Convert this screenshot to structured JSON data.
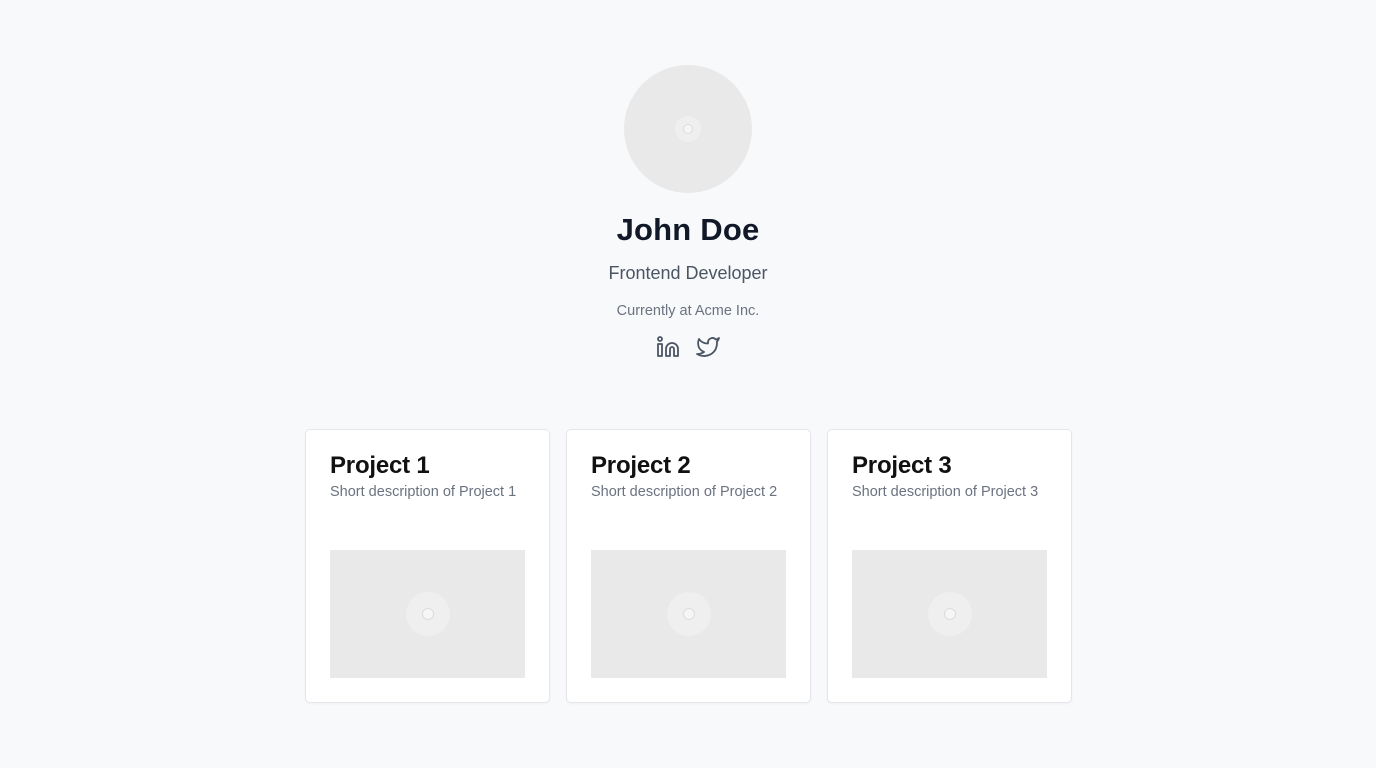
{
  "profile": {
    "avatar_icon": "image-placeholder-icon",
    "name": "John Doe",
    "role": "Frontend Developer",
    "company": "Currently at Acme Inc.",
    "socials": [
      {
        "icon": "linkedin-icon",
        "label": "LinkedIn"
      },
      {
        "icon": "twitter-icon",
        "label": "Twitter"
      }
    ]
  },
  "projects": [
    {
      "title": "Project 1",
      "description": "Short description of Project 1",
      "image_icon": "image-placeholder-icon"
    },
    {
      "title": "Project 2",
      "description": "Short description of Project 2",
      "image_icon": "image-placeholder-icon"
    },
    {
      "title": "Project 3",
      "description": "Short description of Project 3",
      "image_icon": "image-placeholder-icon"
    }
  ],
  "colors": {
    "background": "#f8f9fb",
    "heading": "#111827",
    "muted": "#6b7280",
    "placeholder": "#e9e9e9"
  }
}
